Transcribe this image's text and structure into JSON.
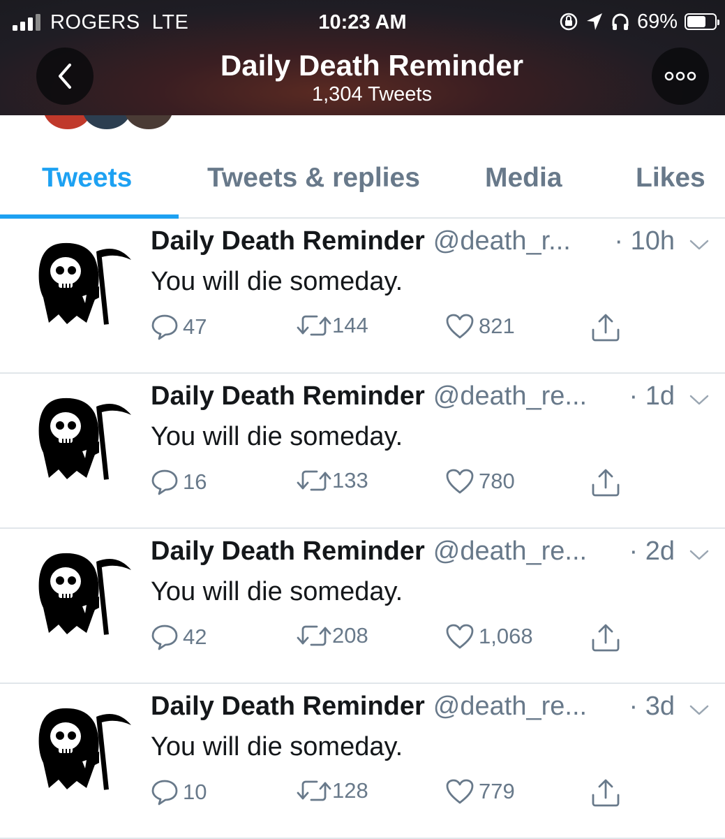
{
  "status_bar": {
    "carrier": "ROGERS  LTE",
    "time": "10:23 AM",
    "battery_percent": "69%",
    "battery_level": 0.69,
    "icons": [
      "signal-icon",
      "orientation-lock-icon",
      "location-arrow-icon",
      "headphones-icon",
      "battery-icon"
    ]
  },
  "header": {
    "title": "Daily Death Reminder",
    "tweet_count": "1,304 Tweets",
    "back_icon": "chevron-left-icon",
    "more_icon": "more-dots-icon",
    "background": "#1c1b21"
  },
  "tabs": [
    {
      "label": "Tweets",
      "active": true
    },
    {
      "label": "Tweets & replies",
      "active": false
    },
    {
      "label": "Media",
      "active": false
    },
    {
      "label": "Likes",
      "active": false
    }
  ],
  "accent_color": "#1da1f2",
  "tweets": [
    {
      "name": "Daily Death Reminder",
      "handle": "@death_r...",
      "time": "· 10h",
      "text": "You will die someday.",
      "replies": "47",
      "retweets": "144",
      "likes": "821"
    },
    {
      "name": "Daily Death Reminder",
      "handle": "@death_re...",
      "time": "· 1d",
      "text": "You will die someday.",
      "replies": "16",
      "retweets": "133",
      "likes": "780"
    },
    {
      "name": "Daily Death Reminder",
      "handle": "@death_re...",
      "time": "· 2d",
      "text": "You will die someday.",
      "replies": "42",
      "retweets": "208",
      "likes": "1,068"
    },
    {
      "name": "Daily Death Reminder",
      "handle": "@death_re...",
      "time": "· 3d",
      "text": "You will die someday.",
      "replies": "10",
      "retweets": "128",
      "likes": "779"
    }
  ]
}
